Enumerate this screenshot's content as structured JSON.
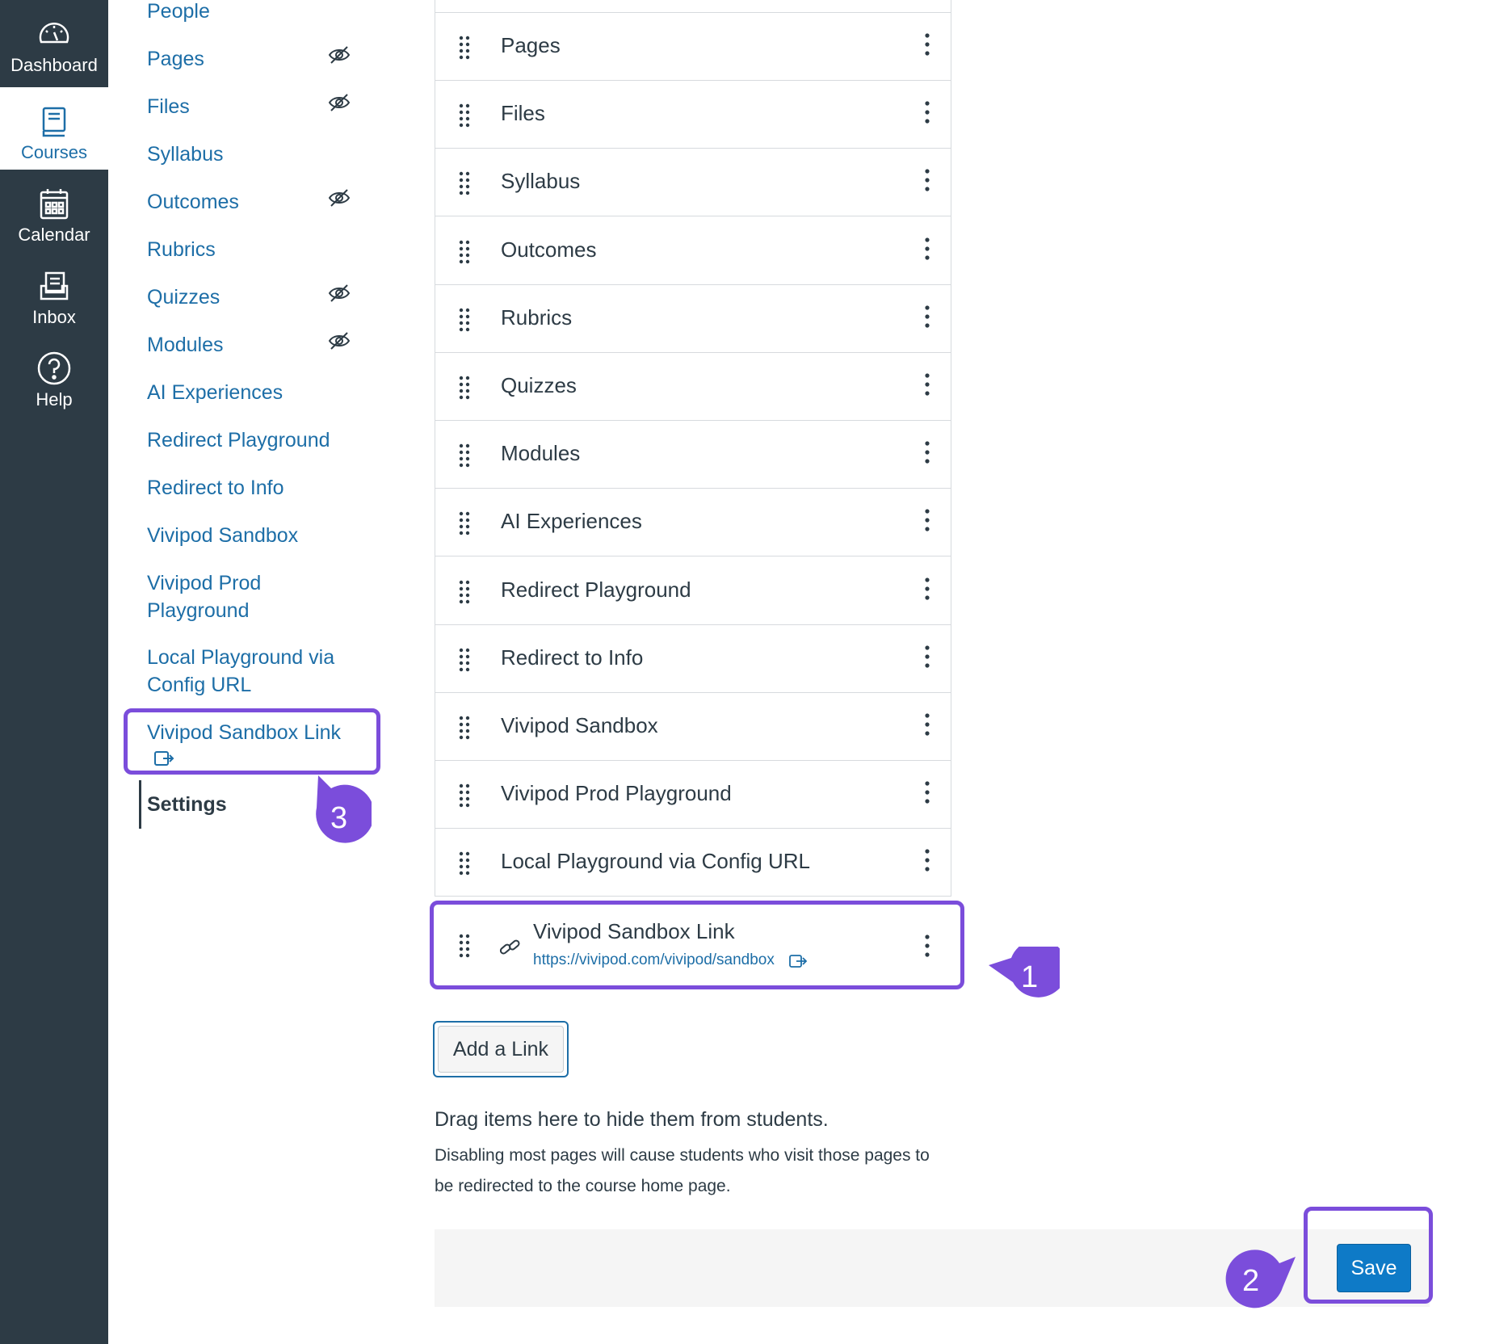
{
  "global_nav": {
    "items": [
      {
        "label": "Dashboard",
        "icon": "dashboard-icon"
      },
      {
        "label": "Courses",
        "icon": "courses-icon",
        "active": true
      },
      {
        "label": "Calendar",
        "icon": "calendar-icon"
      },
      {
        "label": "Inbox",
        "icon": "inbox-icon"
      },
      {
        "label": "Help",
        "icon": "help-icon"
      }
    ]
  },
  "course_nav": {
    "items": [
      {
        "label": "People",
        "hidden": false
      },
      {
        "label": "Pages",
        "hidden": true
      },
      {
        "label": "Files",
        "hidden": true
      },
      {
        "label": "Syllabus",
        "hidden": false
      },
      {
        "label": "Outcomes",
        "hidden": true
      },
      {
        "label": "Rubrics",
        "hidden": false
      },
      {
        "label": "Quizzes",
        "hidden": true
      },
      {
        "label": "Modules",
        "hidden": true
      },
      {
        "label": "AI Experiences",
        "hidden": false
      },
      {
        "label": "Redirect Playground",
        "hidden": false
      },
      {
        "label": "Redirect to Info",
        "hidden": false
      },
      {
        "label": "Vivipod Sandbox",
        "hidden": false
      },
      {
        "label_line1": "Vivipod Prod",
        "label_line2": "Playground",
        "hidden": false
      },
      {
        "label_line1": "Local Playground via",
        "label_line2": "Config URL",
        "hidden": false
      },
      {
        "label": "Vivipod Sandbox Link",
        "external": true
      }
    ],
    "settings_label": "Settings"
  },
  "tabs": {
    "rows": [
      "Pages",
      "Files",
      "Syllabus",
      "Outcomes",
      "Rubrics",
      "Quizzes",
      "Modules",
      "AI Experiences",
      "Redirect Playground",
      "Redirect to Info",
      "Vivipod Sandbox",
      "Vivipod Prod Playground",
      "Local Playground via Config URL"
    ],
    "external_link": {
      "label": "Vivipod Sandbox Link",
      "url": "https://vivipod.com/vivipod/sandbox"
    }
  },
  "add_link_label": "Add a Link",
  "hidden_zone": {
    "title": "Drag items here to hide them from students.",
    "description": "Disabling most pages will cause students who visit those pages to be redirected to the course home page."
  },
  "save_label": "Save",
  "annotations": {
    "badge1": "1",
    "badge2": "2",
    "badge3": "3",
    "color": "#7b4ddb"
  },
  "colors": {
    "nav_bg": "#2d3b45",
    "link": "#1d6ea7",
    "save_bg": "#0e7ac7"
  }
}
